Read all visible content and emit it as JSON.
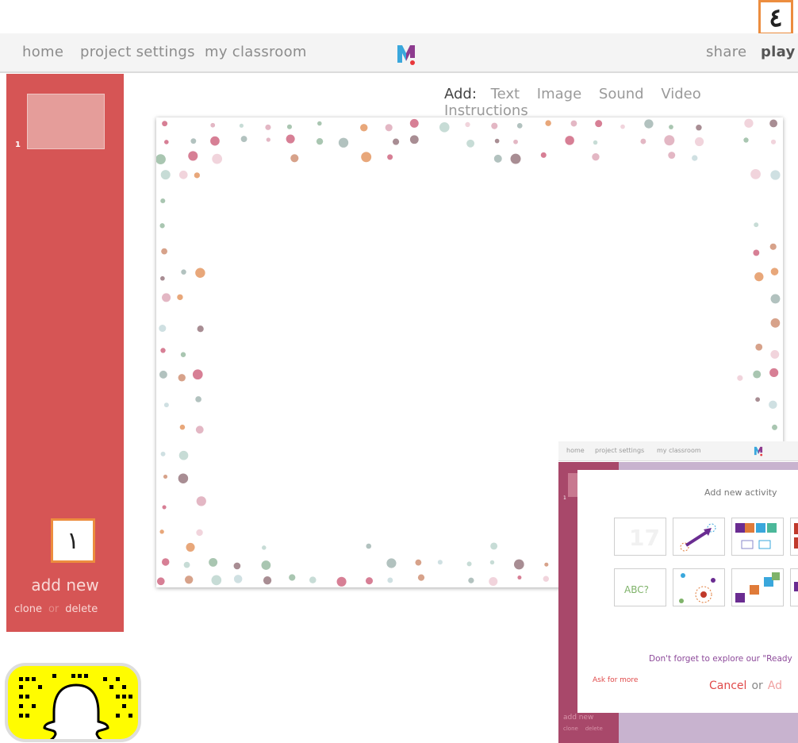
{
  "nav": {
    "home": "home",
    "project_settings": "project settings",
    "my_classroom": "my classroom",
    "share": "share",
    "play": "play"
  },
  "badges": {
    "top_right": "٤",
    "left": "١"
  },
  "slides": [
    {
      "number": "1"
    }
  ],
  "sidebar": {
    "add_new": "add new",
    "clone": "clone",
    "or": "or",
    "delete": "delete"
  },
  "add_menu": {
    "label": "Add:",
    "options": [
      "Text",
      "Image",
      "Sound",
      "Video",
      "Instructions"
    ]
  },
  "overlay": {
    "nav": {
      "home": "home",
      "project_settings": "project settings",
      "my_classroom": "my classroom"
    },
    "slide_number": "1",
    "modal_title": "Add new activity",
    "tile_texts": [
      "ABC?"
    ],
    "note": "Don't forget to explore our \"Ready",
    "ask_for_more": "Ask for more",
    "cancel": "Cancel",
    "or": "or",
    "add": "Ad",
    "add_new": "add new",
    "clone": "clone",
    "delete": "delete"
  },
  "colors": {
    "sidebar": "#d65555",
    "accent_badge": "#ec8d3f",
    "overlay_sidebar": "#a8486a",
    "snapcode": "#fffc00"
  }
}
